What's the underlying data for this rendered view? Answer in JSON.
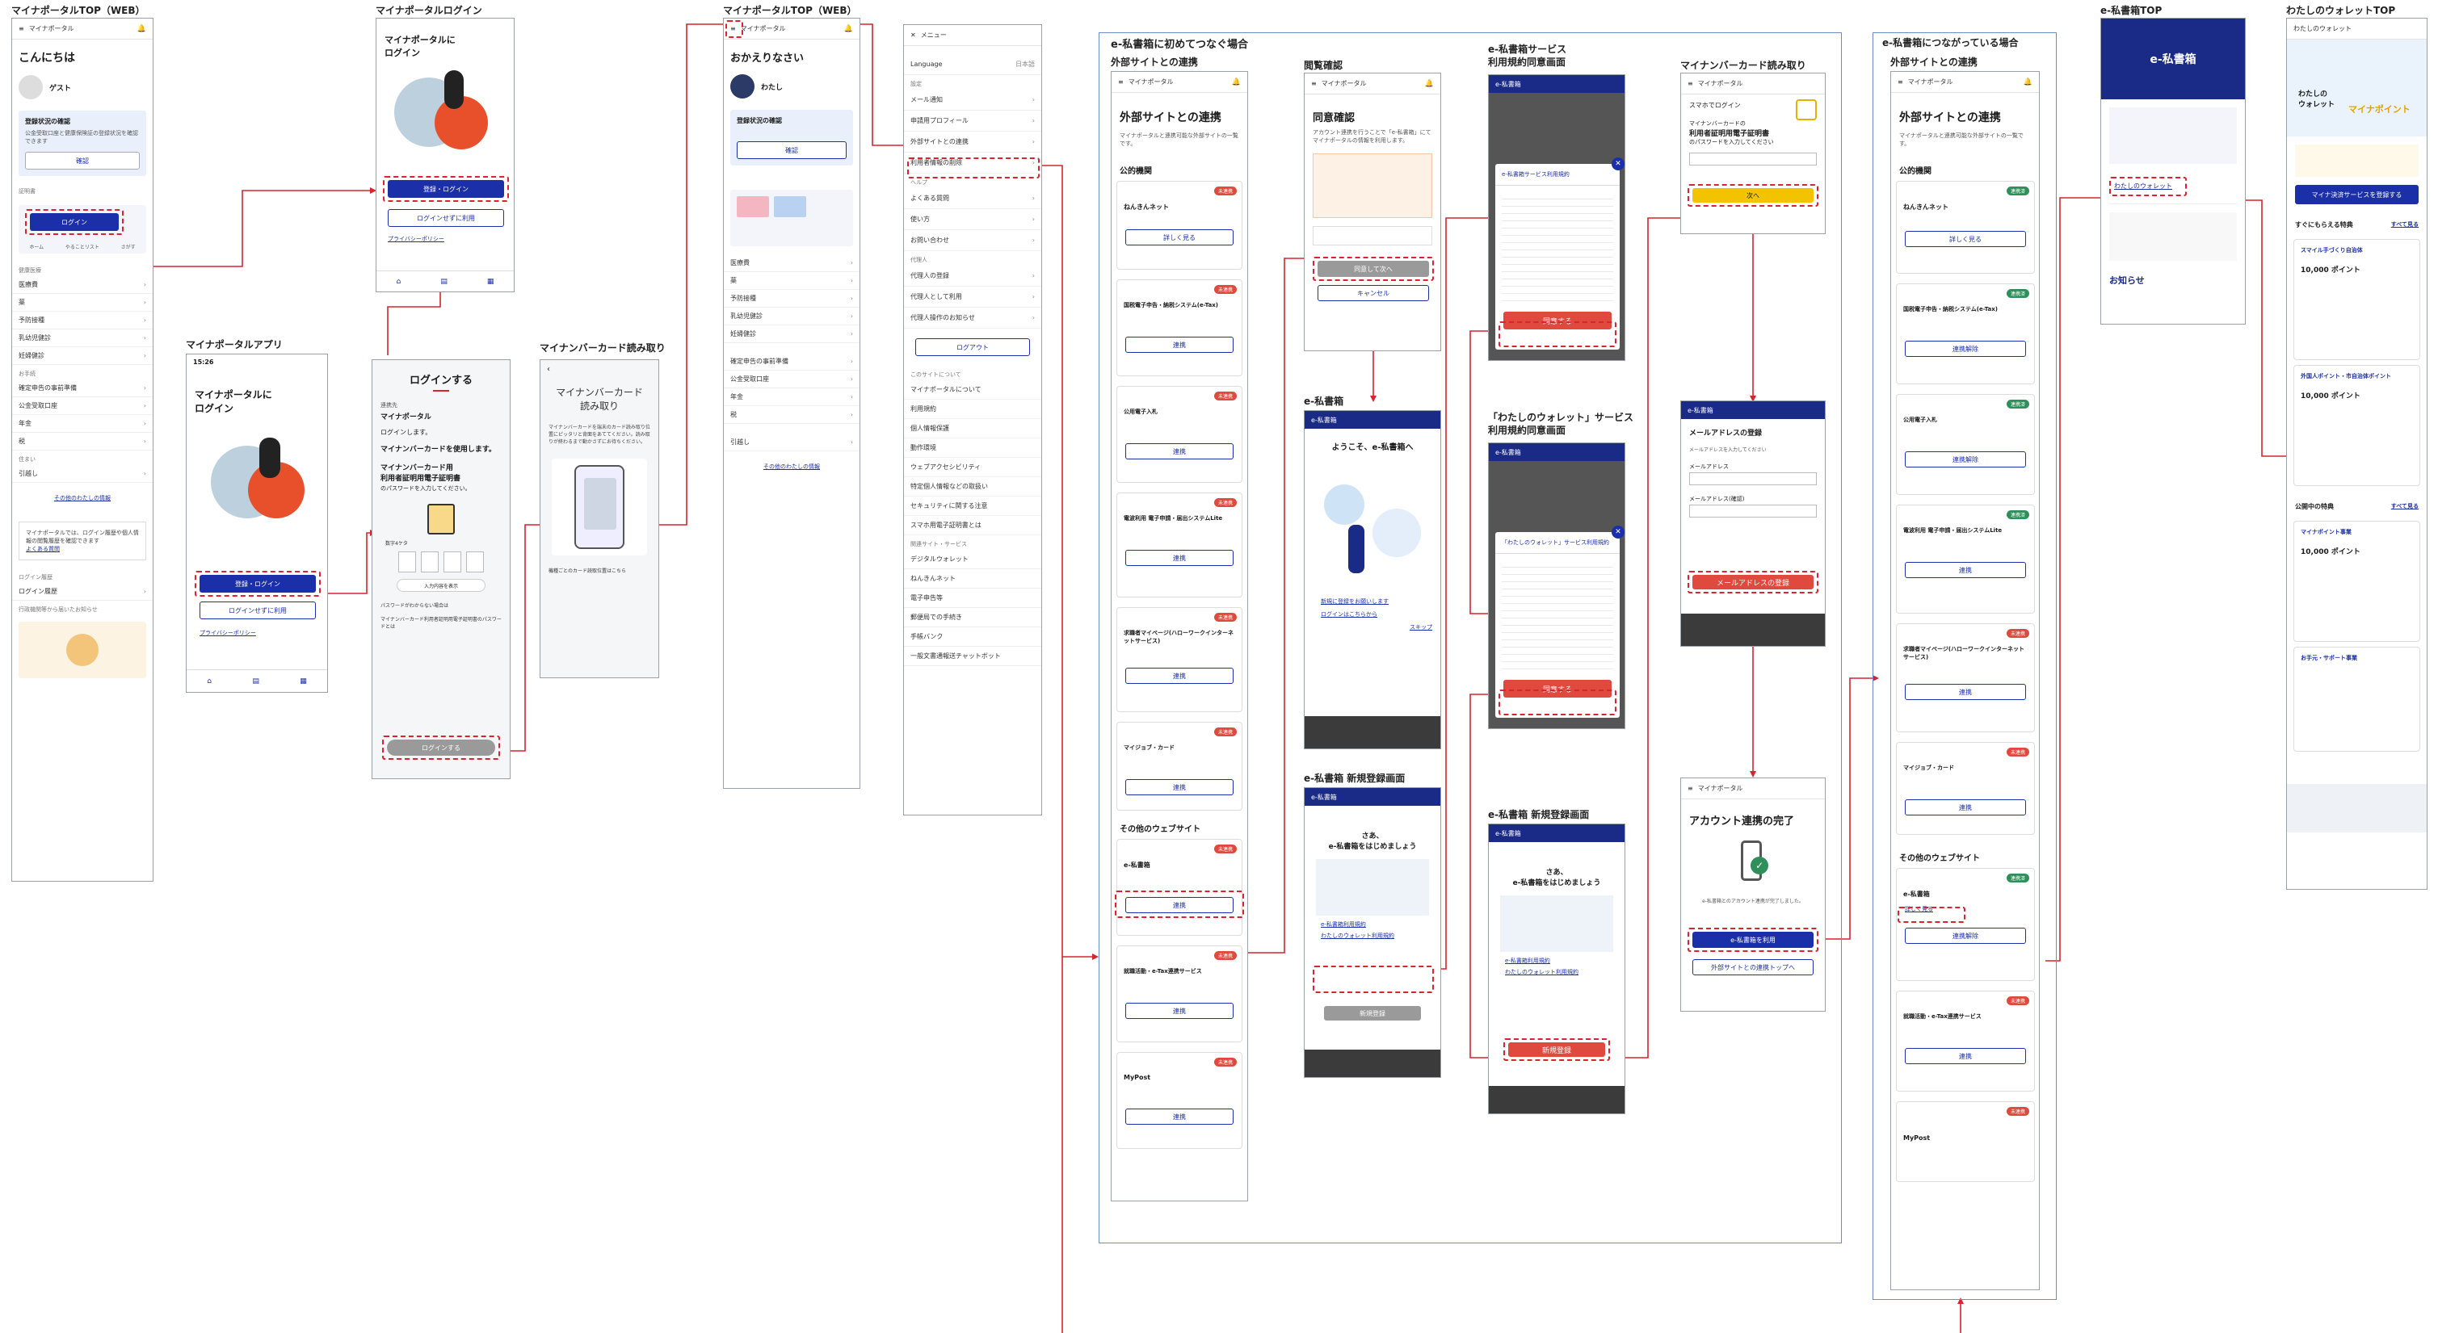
{
  "screens": {
    "s1": {
      "title": "マイナポータルTOP（WEB）",
      "brand": "マイナポータル",
      "greeting": "こんにちは",
      "user": "ゲスト",
      "status_head": "登録状況の確認",
      "status_text": "公金受取口座と健康保険証の登録状況を確認できます",
      "login": "ログイン",
      "section_a": "証明書",
      "section_b": "健康医療",
      "menu": [
        "医療費",
        "薬",
        "予防接種",
        "乳幼児健診",
        "妊婦健診"
      ],
      "section_c": "お手続",
      "menu2": [
        "確定申告の事前準備",
        "公金受取口座",
        "年金",
        "税"
      ],
      "section_d": "住まい",
      "menu3": [
        "引越し"
      ],
      "more": "その他のわたしの情報",
      "notice": "マイナポータルでは、ログイン履歴や個人情報の閲覧履歴を確認できます",
      "notice_link": "よくある質問",
      "login_hist": "ログイン履歴",
      "footer_q": "行政機関等から届いたお知らせ",
      "tabs": [
        "ホーム",
        "やることリスト",
        "さがす"
      ]
    },
    "s2": {
      "title": "マイナポータルアプリ",
      "time": "15:26",
      "heading": "マイナポータルに\nログイン",
      "register": "登録・ログイン",
      "nologin": "ログインせずに利用",
      "privacy": "プライバシーポリシー"
    },
    "s3": {
      "title": "マイナポータルログイン",
      "heading": "マイナポータルに\nログイン",
      "register": "登録・ログイン",
      "nologin": "ログインせずに利用",
      "privacy": "プライバシーポリシー"
    },
    "s4": {
      "title": "",
      "heading": "ログインする",
      "label1": "連携先",
      "svc": "マイナポータル",
      "line1": "ログインします。",
      "line2": "マイナンバーカードを使用します。",
      "line3": "マイナンバーカード用\n利用者証明用電子証明書",
      "line4": "のパスワードを入力してください。",
      "pw_label": "数字4ケタ",
      "show": "入力内容を表示",
      "opt1": "パスワードがわからない場合は",
      "opt2": "マイナンバーカード利用者証明用電子証明書のパスワードとは",
      "login": "ログインする"
    },
    "s5": {
      "title": "マイナンバーカード読み取り",
      "heading": "マイナンバーカード\n読み取り",
      "desc": "マイナンバーカードを端末のカード読み取り位置にピッタリと背面をあててください。読み取りが終わるまで動かさずにお待ちください。",
      "hint": "機種ごとのカード読取位置はこちら"
    },
    "s6": {
      "title": "マイナポータルTOP（WEB）",
      "brand": "マイナポータル",
      "greeting": "おかえりなさい",
      "user": "わたし",
      "status_head": "登録状況の確認",
      "confirm": "確認",
      "menu": [
        "医療費",
        "薬",
        "予防接種",
        "乳幼児健診",
        "妊婦健診"
      ],
      "menu2": [
        "確定申告の事前準備",
        "公金受取口座",
        "年金",
        "税"
      ],
      "menu3": [
        "引越し"
      ],
      "more": "その他のわたしの情報"
    },
    "s7": {
      "title": "",
      "close": "メニュー",
      "lang": "Language",
      "lang_val": "日本語",
      "sec1": "設定",
      "items1": [
        "メール通知",
        "申請用プロフィール",
        "外部サイトとの連携",
        "利用者情報の削除"
      ],
      "sec2": "ヘルプ",
      "items2": [
        "よくある質問",
        "使い方",
        "お問い合わせ"
      ],
      "sec3": "代理人",
      "items3": [
        "代理人の登録",
        "代理人として利用",
        "代理人操作のお知らせ"
      ],
      "logout": "ログアウト",
      "sec4": "このサイトについて",
      "items4": [
        "マイナポータルについて",
        "利用規約",
        "個人情報保護",
        "動作環境",
        "ウェブアクセシビリティ",
        "特定個人情報などの取扱い",
        "セキュリティに関する注意",
        "スマホ用電子証明書とは"
      ],
      "sec5": "関連サイト・サービス",
      "items5": [
        "デジタルウォレット",
        "ねんきんネット",
        "電子申告等",
        "郵便局での手続き",
        "手帳バンク",
        "一般文書通報送チャットボット"
      ]
    },
    "g1": {
      "title": "e-私書箱に初めてつなぐ場合"
    },
    "s8": {
      "title": "外部サイトとの連携",
      "brand": "マイナポータル",
      "heading": "外部サイトとの連携",
      "desc": "マイナポータルと連携可能な外部サイトの一覧です。",
      "sec1": "公的機関",
      "items": [
        "ねんきんネット",
        "国税電子申告・納税システム(e-Tax)",
        "公用電子入札",
        "電波利用 電子申請・届出システムLite",
        "求職者マイページ(ハローワークインターネットサービス)",
        "マイジョブ・カード"
      ],
      "sec2": "その他のウェブサイト",
      "items2": [
        "e-私書箱",
        "就職活動・e-Tax連携サービス",
        "MyPost"
      ],
      "btn": "連携",
      "detail": "詳しく見る",
      "badge": "未連携"
    },
    "s9": {
      "title": "閲覧確認",
      "brand": "マイナポータル",
      "heading": "同意確認",
      "desc": "アカウント連携を行うことで「e-私書箱」にてマイナポータルの情報を利用します。",
      "agree": "同意して次へ",
      "cancel": "キャンセル"
    },
    "s10": {
      "title": "e-私書箱",
      "logo": "e-私書箱",
      "welcome": "ようこそ、e-私書箱へ",
      "link1": "新規に登録をお願いします",
      "link2": "ログインはこちらから",
      "skip": "スキップ"
    },
    "s11": {
      "title": "e-私書箱 新規登録画面",
      "logo": "e-私書箱",
      "hero": "さあ、\ne-私書箱をはじめましょう",
      "t1": "e-私書箱利用規約",
      "t2": "わたしのウォレット利用規約",
      "next": "新規登録"
    },
    "s12": {
      "title": "e-私書箱サービス\n利用規約同意画面",
      "logo": "e-私書箱",
      "modal": "e-私書箱サービス利用規約",
      "agree": "同意する"
    },
    "s13": {
      "title": "「わたしのウォレット」サービス\n利用規約同意画面",
      "logo": "e-私書箱",
      "modal": "「わたしのウォレット」サービス利用規約",
      "agree": "同意する"
    },
    "s14": {
      "title": "e-私書箱 新規登録画面",
      "logo": "e-私書箱",
      "hero": "さあ、\ne-私書箱をはじめましょう",
      "t1": "e-私書箱利用規約",
      "t2": "わたしのウォレット利用規約",
      "next": "新規登録"
    },
    "s15": {
      "title": "マイナンバーカード読み取り",
      "brand": "マイナポータル",
      "sub": "スマホでログイン",
      "line1": "マイナンバーカードの",
      "line2": "利用者証明用電子証明書",
      "line3": "のパスワードを入力してください",
      "next": "次へ"
    },
    "s16": {
      "title": "",
      "logo": "e-私書箱",
      "heading": "メールアドレスの登録",
      "desc": "メールアドレスを入力してください",
      "f1": "メールアドレス",
      "f2": "メールアドレス(確認)",
      "submit": "メールアドレスの登録"
    },
    "s17": {
      "title": "",
      "brand": "マイナポータル",
      "heading": "アカウント連携の完了",
      "desc": "e-私書箱とのアカウント連携が完了しました。",
      "btn1": "e-私書箱を利用",
      "btn2": "外部サイトとの連携トップへ"
    },
    "g2": {
      "title": "e-私書箱につながっている場合"
    },
    "s18": {
      "title": "外部サイトとの連携",
      "brand": "マイナポータル",
      "heading": "外部サイトとの連携",
      "desc": "マイナポータルと連携可能な外部サイトの一覧です。",
      "sec1": "公的機関",
      "items": [
        "ねんきんネット",
        "国税電子申告・納税システム(e-Tax)",
        "公用電子入札",
        "電波利用 電子申請・届出システムLite",
        "求職者マイページ(ハローワークインターネットサービス)",
        "マイジョブ・カード"
      ],
      "sec2": "その他のウェブサイト",
      "items2": [
        "e-私書箱",
        "就職活動・e-Tax連携サービス",
        "MyPost"
      ],
      "btn": "連携",
      "btn_off": "連携解除",
      "detail": "詳しく見る",
      "badge_on": "連携済",
      "badge_off": "未連携"
    },
    "s19": {
      "title": "e-私書箱TOP",
      "logo": "e-私書箱",
      "link": "わたしのウォレット",
      "news": "お知らせ"
    },
    "s20": {
      "title": "わたしのウォレットTOP",
      "brand": "わたしのウォレット",
      "hero": "わたしの\nウォレット",
      "accent": "マイナポイント",
      "cta": "マイナ決済サービスを登録する",
      "sec1": "すぐにもらえる特典",
      "more": "すべて見る",
      "c1": "スマイル手づくり自治体",
      "c2": "外国人ポイント・市自治体ポイント",
      "c3": "マイナポイント事業",
      "c4": "お手元・サポート事業",
      "pts": "10,000 ポイント",
      "sec2": "公開中の特典"
    }
  }
}
